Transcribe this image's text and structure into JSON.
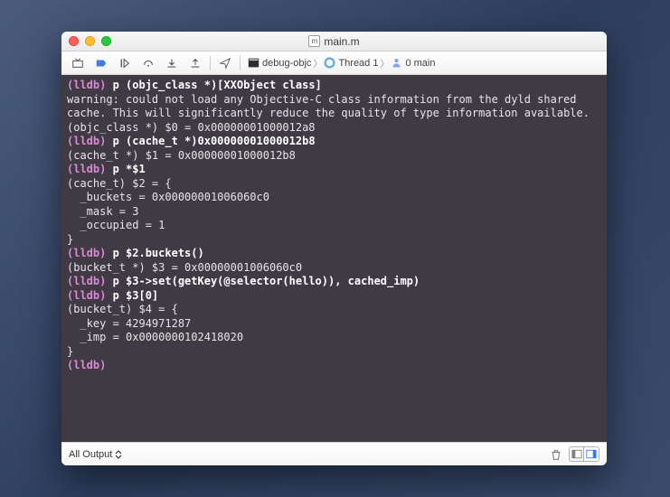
{
  "window": {
    "title": "main.m"
  },
  "breadcrumb": {
    "target": "debug-objc",
    "thread": "Thread 1",
    "frame": "0 main"
  },
  "console_lines": [
    {
      "prompt": "(lldb)",
      "cmd": "p (objc_class *)[XXObject class]"
    },
    {
      "out": "warning: could not load any Objective-C class information from the dyld shared cache. This will significantly reduce the quality of type information available."
    },
    {
      "out": "(objc_class *) $0 = 0x00000001000012a8"
    },
    {
      "prompt": "(lldb)",
      "cmd": "p (cache_t *)0x00000001000012b8"
    },
    {
      "out": "(cache_t *) $1 = 0x00000001000012b8"
    },
    {
      "prompt": "(lldb)",
      "cmd": "p *$1"
    },
    {
      "out": "(cache_t) $2 = {"
    },
    {
      "out": "  _buckets = 0x00000001006060c0"
    },
    {
      "out": "  _mask = 3"
    },
    {
      "out": "  _occupied = 1"
    },
    {
      "out": "}"
    },
    {
      "prompt": "(lldb)",
      "cmd": "p $2.buckets()"
    },
    {
      "out": "(bucket_t *) $3 = 0x00000001006060c0"
    },
    {
      "prompt": "(lldb)",
      "cmd": "p $3->set(getKey(@selector(hello)), cached_imp)"
    },
    {
      "prompt": "(lldb)",
      "cmd": "p $3[0]"
    },
    {
      "out": "(bucket_t) $4 = {"
    },
    {
      "out": "  _key = 4294971287"
    },
    {
      "out": "  _imp = 0x0000000102418020"
    },
    {
      "out": "}"
    },
    {
      "prompt": "(lldb)",
      "cmd": ""
    }
  ],
  "bottombar": {
    "filter": "All Output"
  }
}
